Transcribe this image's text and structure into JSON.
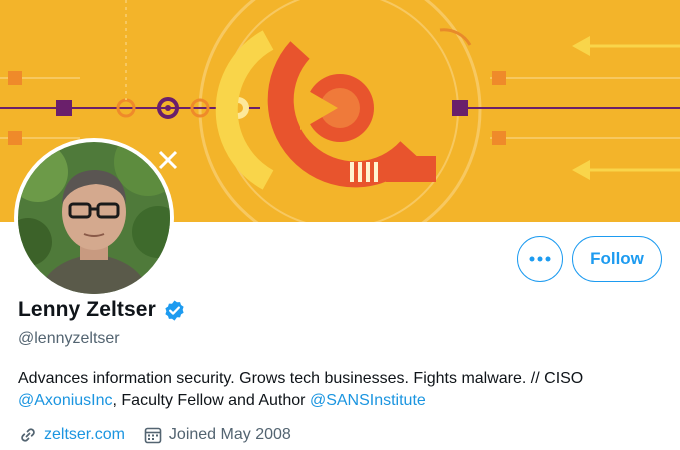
{
  "profile": {
    "display_name": "Lenny Zeltser",
    "handle": "@lennyzeltser",
    "verified_icon": "verified-badge-icon"
  },
  "actions": {
    "more_label": "•••",
    "follow_label": "Follow"
  },
  "bio": {
    "part1": "Advances information security. Grows tech businesses. Fights malware. // CISO ",
    "mention1": "@AxoniusInc",
    "part2": ", Faculty Fellow and Author ",
    "mention2": "@SANSInstitute"
  },
  "meta": {
    "website": "zeltser.com",
    "website_icon": "link-icon",
    "joined": "Joined May 2008",
    "joined_icon": "calendar-icon"
  },
  "colors": {
    "accent": "#1d9bf0",
    "banner_yellow": "#f3b42a",
    "banner_orange": "#e8542d",
    "banner_purple": "#6a1f6b"
  }
}
